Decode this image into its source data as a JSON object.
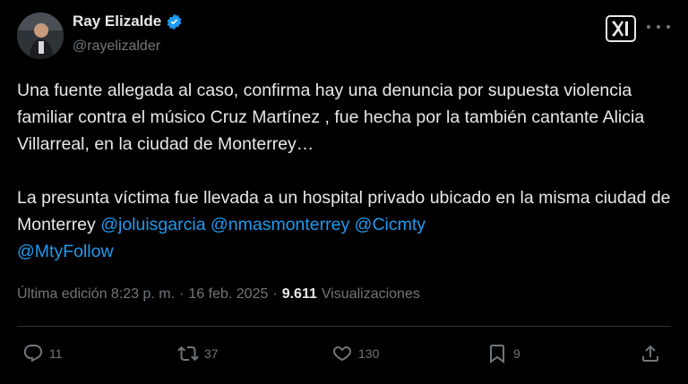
{
  "author": {
    "name": "Ray Elizalde",
    "handle": "@rayelizalder",
    "verified": true
  },
  "brand": {
    "icon": "x-logo-icon"
  },
  "tweet": {
    "paragraph1": "Una fuente allegada al caso, confirma hay una denuncia por supuesta violencia familiar contra el músico Cruz Martínez , fue hecha por la también cantante Alicia Villarreal, en la ciudad de Monterrey…",
    "paragraph2_text": "La presunta víctima fue llevada a un hospital privado ubicado en la misma ciudad de Monterrey ",
    "mentions": [
      "@joluisgarcia",
      "@nmasmonterrey",
      "@Cicmty",
      "@MtyFollow"
    ]
  },
  "meta": {
    "edited_time": "Última edición 8:23 p. m.",
    "separator": "·",
    "date": "16 feb. 2025",
    "views_count": "9.611",
    "views_label": "Visualizaciones"
  },
  "actions": {
    "replies": "11",
    "reposts": "37",
    "likes": "130",
    "bookmarks": "9"
  },
  "colors": {
    "background": "#000000",
    "text": "#e7e9ea",
    "muted": "#71767b",
    "link": "#1d9bf0",
    "verified": "#1d9bf0",
    "divider": "#2f3336"
  }
}
